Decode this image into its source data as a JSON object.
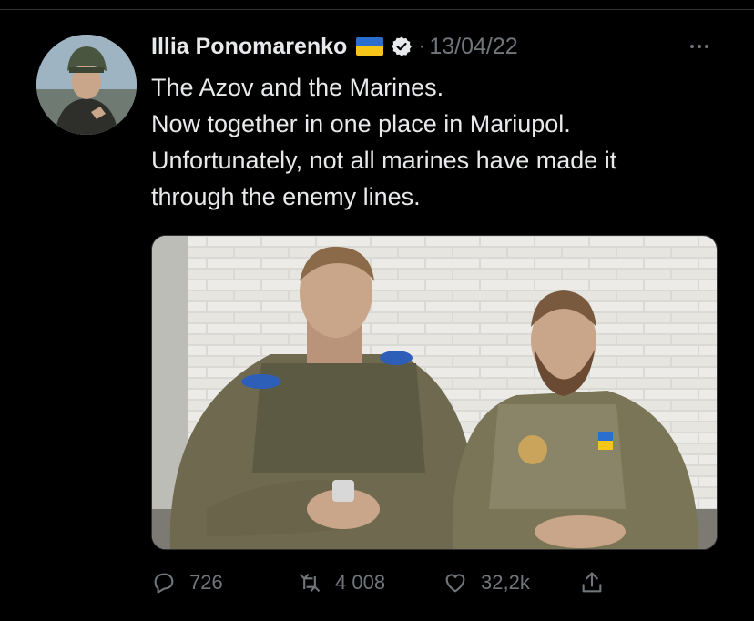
{
  "tweet": {
    "author_name": "Illia Ponomarenko",
    "separator": "·",
    "date": "13/04/22",
    "text_lines": [
      "The Azov and the Marines.",
      "Now together in one place in Mariupol.",
      "Unfortunately, not all marines have made it",
      "through the enemy lines."
    ]
  },
  "actions": {
    "replies": "726",
    "retweets": "4 008",
    "likes": "32,2k"
  },
  "icons": {
    "avatar": "profile-photo",
    "flag": "ukraine-flag-emoji",
    "verified": "verified-badge-icon",
    "more": "more-dots-icon",
    "reply": "reply-icon",
    "retweet": "retweet-icon",
    "like": "heart-icon",
    "share": "share-icon"
  },
  "colors": {
    "background": "#000000",
    "text": "#e7e9ea",
    "secondary": "#71767b",
    "divider": "#2f3336",
    "flag_blue": "#2a6fd0",
    "flag_yellow": "#f5c518"
  }
}
